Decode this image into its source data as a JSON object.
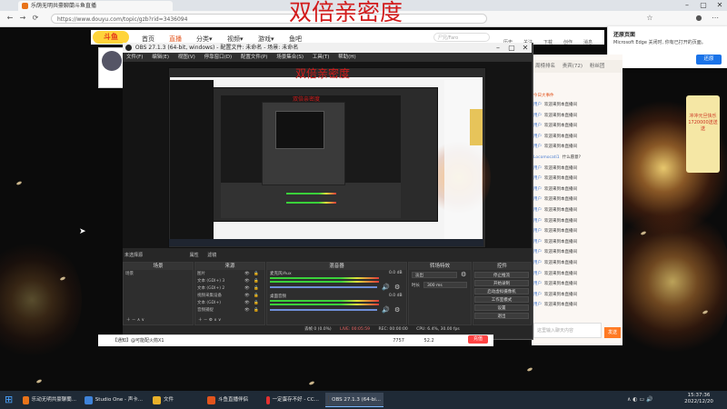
{
  "overlay_title": "双倍亲密度",
  "browser": {
    "tab_title": "乐荫无明共豪聊蘭斗鱼直播",
    "url": "https://www.douyu.com/topic/gzb?rid=3436094",
    "back_icon": "back-arrow-icon",
    "refresh_icon": "refresh-icon",
    "home_icon": "home-icon"
  },
  "site": {
    "logo": "斗鱼",
    "nav": [
      {
        "label": "首页"
      },
      {
        "label": "直播"
      },
      {
        "label": "分类▾"
      },
      {
        "label": "视频▾"
      },
      {
        "label": "游戏▾"
      },
      {
        "label": "鱼吧"
      }
    ],
    "search_placeholder": "尸兄/Faro",
    "header_icons": [
      "历史",
      "关注",
      "下载",
      "创作",
      "消息"
    ]
  },
  "edge_popup": {
    "title": "还原页面",
    "message": "Microsoft Edge 关闭时, 你有已打开的页面。",
    "button": "还原"
  },
  "obs": {
    "title": "OBS 27.1.3 (64-bit, windows) - 配置文件: 未命名 - 场景: 未命名",
    "menu": [
      "文件(F)",
      "编辑(E)",
      "视图(V)",
      "停靠窗口(D)",
      "配置文件(P)",
      "场景集合(S)",
      "工具(T)",
      "帮助(H)"
    ],
    "selected_source": "未选择源",
    "props_btn": "属性",
    "filters_btn": "滤镜",
    "docks": {
      "scenes": {
        "title": "场景",
        "items": [
          "场景"
        ]
      },
      "sources": {
        "title": "来源",
        "items": [
          "图片",
          "文本 (GDI+) 3",
          "文本 (GDI+) 2",
          "视频采集设备",
          "文本 (GDI+)",
          "音频捕捉"
        ]
      },
      "mixer": {
        "title": "混音器",
        "channels": [
          {
            "name": "麦克风/Aux",
            "db": "0.0 dB"
          },
          {
            "name": "桌面音频",
            "db": "0.0 dB"
          }
        ]
      },
      "transitions": {
        "title": "转场特效",
        "type": "淡出",
        "duration_label": "时长",
        "duration": "300 ms"
      },
      "controls": {
        "title": "控件",
        "buttons": [
          "停止推流",
          "开始录制",
          "启动虚拟摄像机",
          "工作室模式",
          "设置",
          "退出"
        ]
      }
    },
    "status": {
      "live": "LIVE: 00:05:59",
      "rec": "REC: 00:00:00",
      "cpu": "CPU: 6.4%, 30.00 fps",
      "dropped": "丢帧 0 (0.0%)"
    }
  },
  "chat": {
    "tabs": [
      "周榜排名",
      "贵宾(72)",
      "粉丝团"
    ],
    "notice_label": "今日大事件",
    "rows": [
      {
        "name": "用户",
        "text": "欢迎来到本直播间"
      },
      {
        "name": "用户",
        "text": "欢迎来到本直播间"
      },
      {
        "name": "用户",
        "text": "欢迎来到本直播间"
      },
      {
        "name": "用户",
        "text": "欢迎来到本直播间"
      },
      {
        "name": "用户",
        "text": "欢迎来到本直播间"
      },
      {
        "name": "Locomocati1",
        "text": "什么愿意?"
      },
      {
        "name": "用户",
        "text": "欢迎来到本直播间"
      },
      {
        "name": "用户",
        "text": "欢迎来到本直播间"
      },
      {
        "name": "用户",
        "text": "欢迎来到本直播间"
      },
      {
        "name": "用户",
        "text": "欢迎来到本直播间"
      },
      {
        "name": "用户",
        "text": "欢迎来到本直播间"
      },
      {
        "name": "用户",
        "text": "欢迎来到本直播间"
      },
      {
        "name": "用户",
        "text": "欢迎来到本直播间"
      },
      {
        "name": "用户",
        "text": "欢迎来到本直播间"
      },
      {
        "name": "用户",
        "text": "欢迎来到本直播间"
      },
      {
        "name": "用户",
        "text": "欢迎来到本直播间"
      },
      {
        "name": "用户",
        "text": "欢迎来到本直播间"
      },
      {
        "name": "用户",
        "text": "欢迎来到本直播间"
      },
      {
        "name": "用户",
        "text": "欢迎来到本直播间"
      },
      {
        "name": "用户",
        "text": "欢迎来到本直播间"
      }
    ],
    "input_placeholder": "这里输入聊天内容",
    "send": "发送"
  },
  "side_ad": "冲冲元旦快乐 1720000送送送",
  "gift_bar": {
    "text": "【通知】@可能配火箭X1",
    "count_a": "7757",
    "count_b": "52.2",
    "recharge": "充值"
  },
  "taskbar": {
    "items": [
      {
        "label": "乐动无明共豪聊蘭...",
        "color": "#e8731a"
      },
      {
        "label": "Studio One - 声卡...",
        "color": "#3f83d9"
      },
      {
        "label": "文件",
        "color": "#e8b02a"
      },
      {
        "label": "斗鱼直播伴侣",
        "color": "#e2541d"
      },
      {
        "label": "一定蛋存不好 - CC...",
        "color": "#e43030"
      },
      {
        "label": "OBS 27.1.3 (64-bi...",
        "color": "#444444"
      }
    ],
    "time": "15:37:36",
    "date": "2022/12/20"
  }
}
